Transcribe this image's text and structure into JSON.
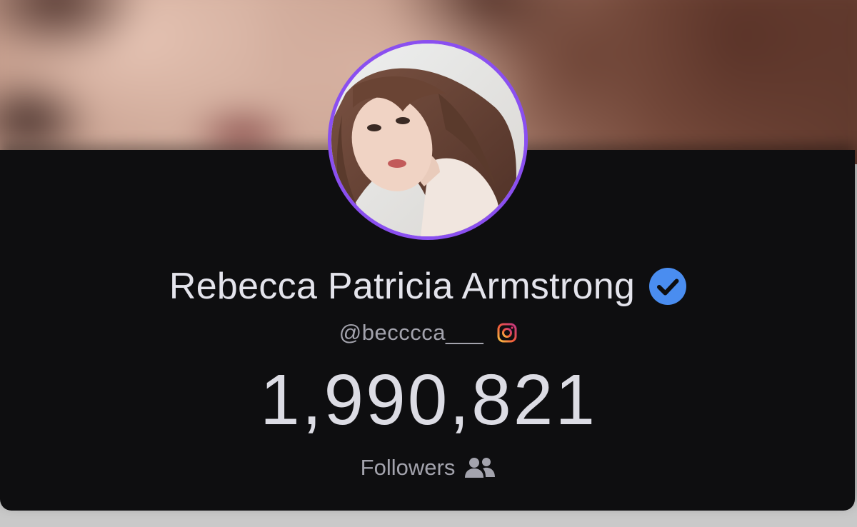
{
  "profile": {
    "name": "Rebecca Patricia Armstrong",
    "verified": true,
    "handle": "@becccca___",
    "platform_icon": "instagram-icon",
    "follower_count": "1,990,821",
    "followers_label": "Followers",
    "followers_icon": "users-icon"
  },
  "colors": {
    "background": "#0e0e10",
    "avatar_ring": "#8a4ff0",
    "verified_badge": "#4a8df0",
    "primary_text": "#e4e4ec",
    "secondary_text": "#a3a3ad"
  }
}
